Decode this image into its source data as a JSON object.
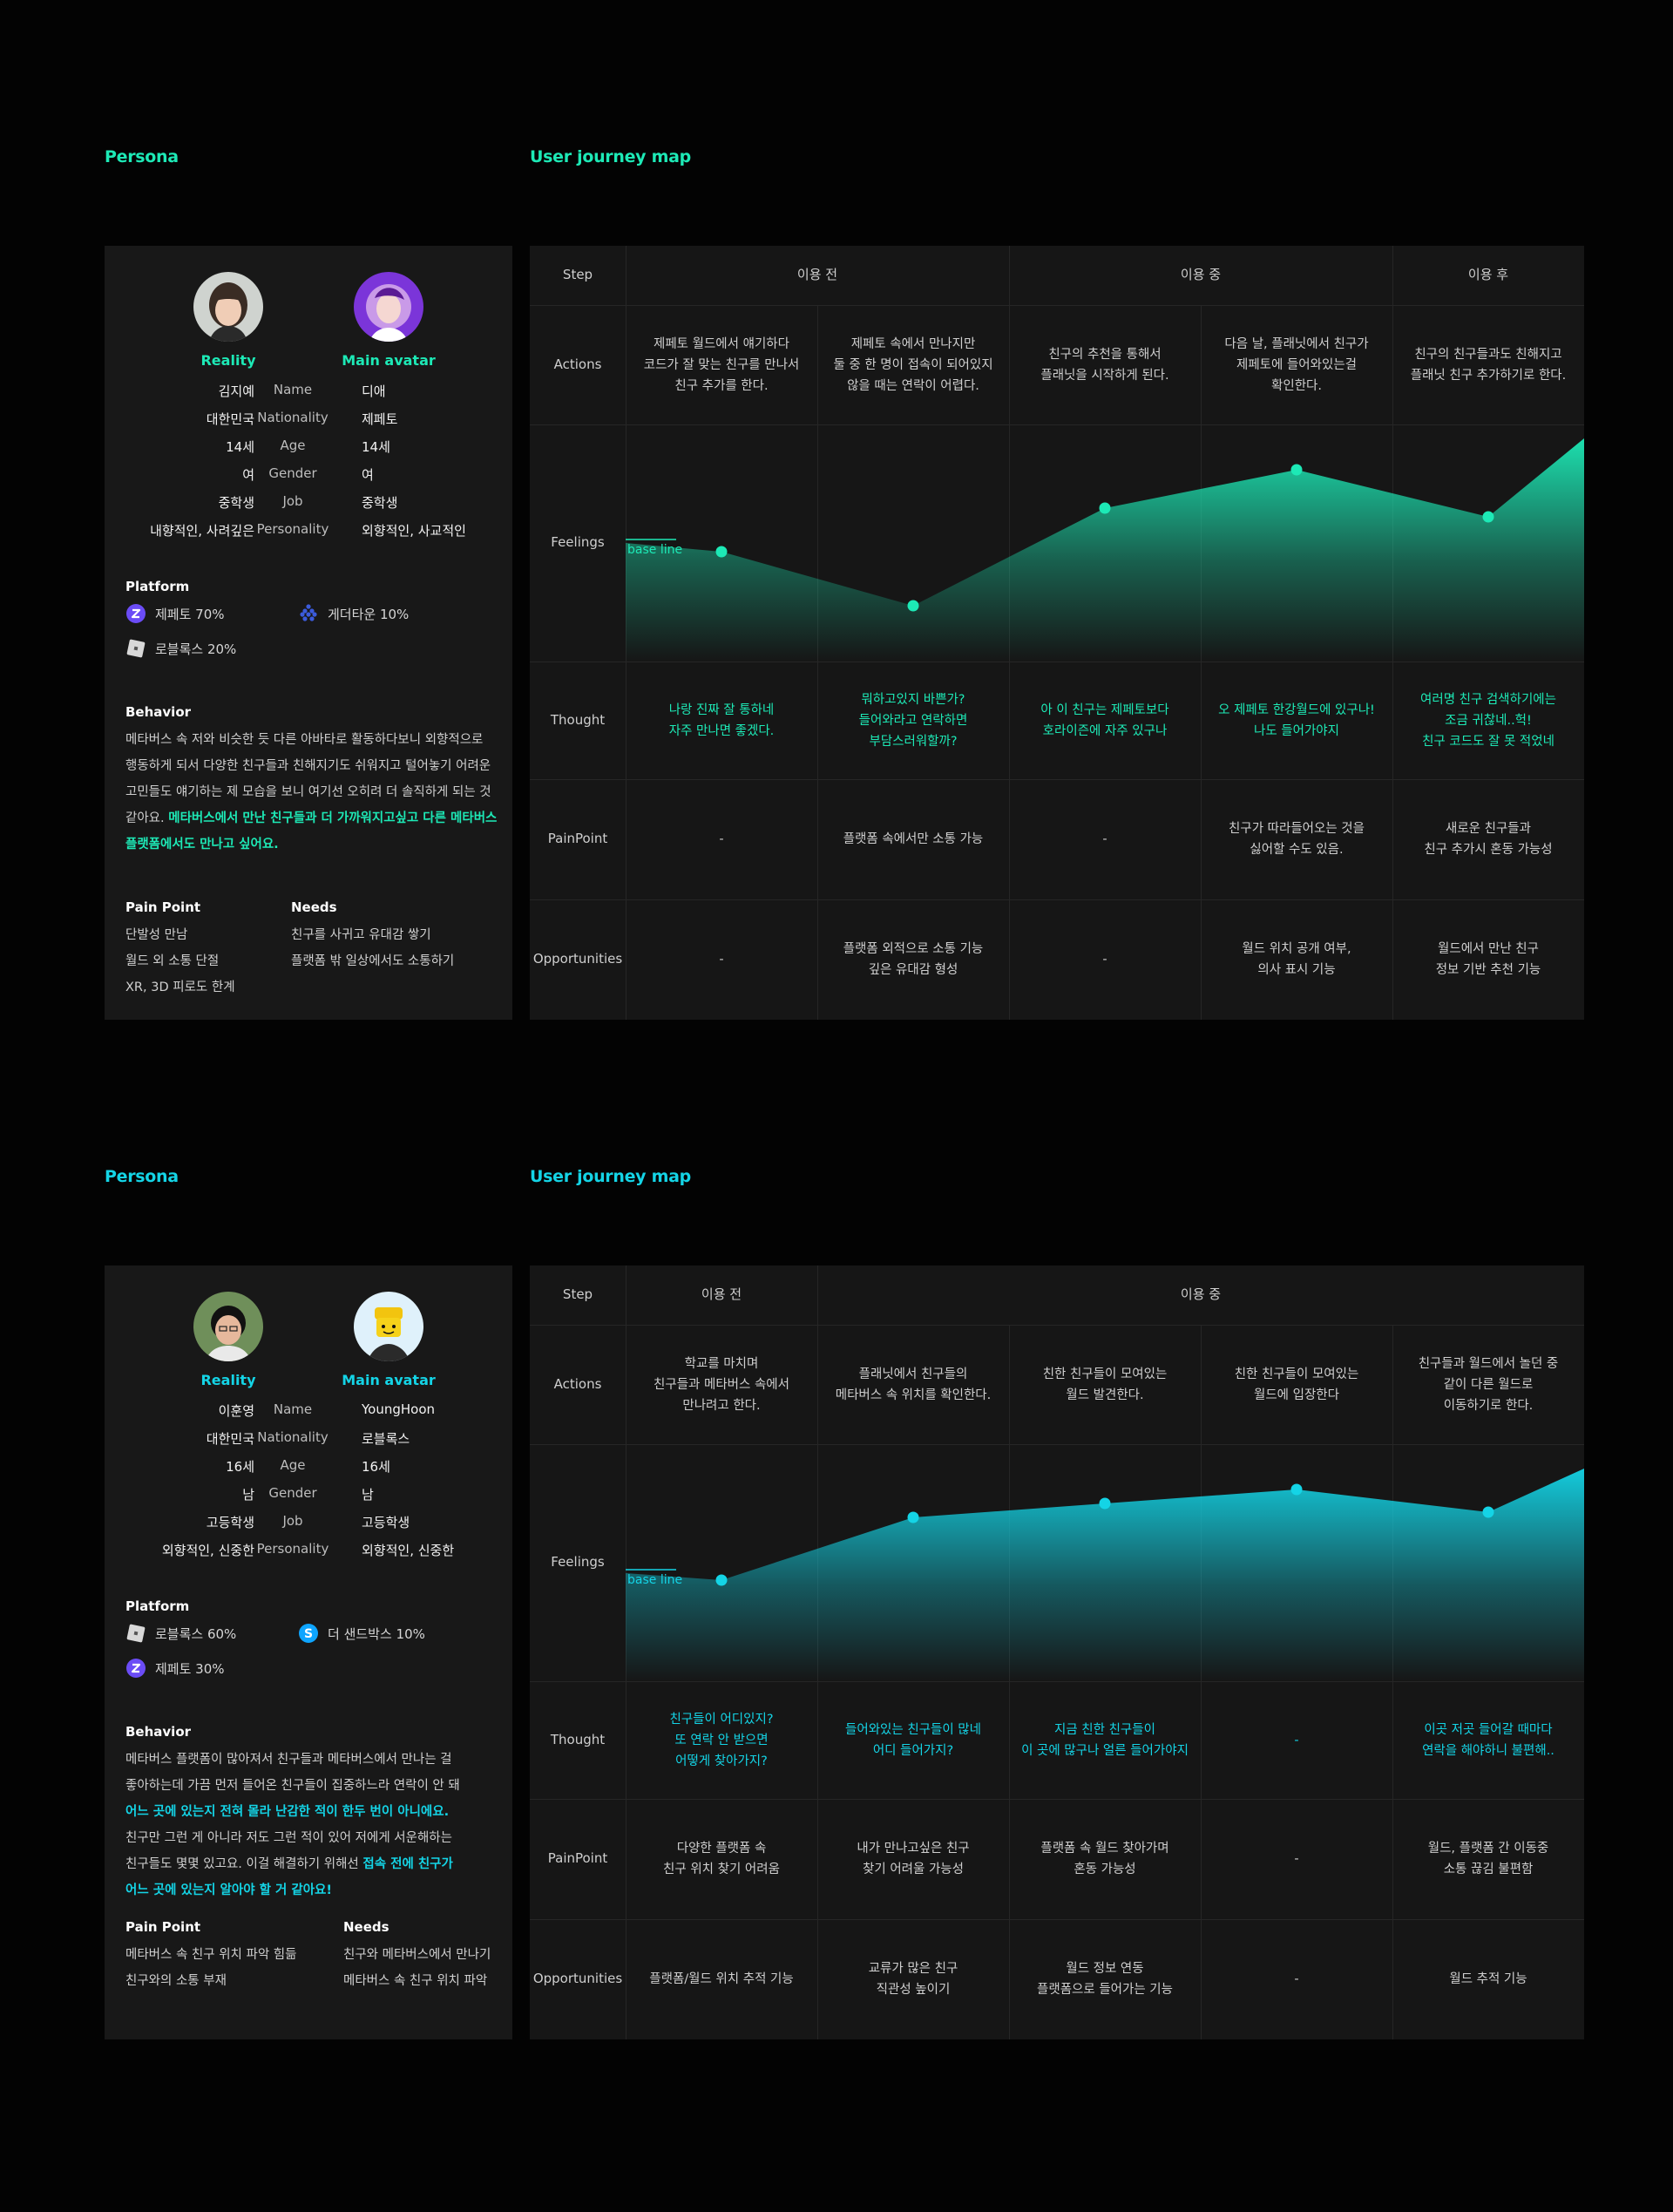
{
  "colors": {
    "accent_1": "#1de9b6",
    "accent_2": "#14d4e6",
    "bg": "#030303",
    "card": "#181818"
  },
  "sections": [
    {
      "persona_title": "Persona",
      "journey_title": "User journey map",
      "accent": "#1de9b6",
      "reality_label": "Reality",
      "avatar_label": "Main avatar",
      "attributes": [
        {
          "name": "Name",
          "reality": "김지예",
          "avatar": "디애"
        },
        {
          "name": "Nationality",
          "reality": "대한민국",
          "avatar": "제페토"
        },
        {
          "name": "Age",
          "reality": "14세",
          "avatar": "14세"
        },
        {
          "name": "Gender",
          "reality": "여",
          "avatar": "여"
        },
        {
          "name": "Job",
          "reality": "중학생",
          "avatar": "중학생"
        },
        {
          "name": "Personality",
          "reality": "내향적인, 사려깊은",
          "avatar": "외향적인, 사교적인"
        }
      ],
      "platform_title": "Platform",
      "platforms": [
        {
          "icon": "zepeto-icon",
          "label": "제페토 70%"
        },
        {
          "icon": "gather-town-icon",
          "label": "게더타운 10%"
        },
        {
          "icon": "roblox-icon",
          "label": "로블록스 20%"
        }
      ],
      "behavior_title": "Behavior",
      "behavior_lines": [
        {
          "text": "메타버스 속 저와 비슷한 듯 다른 아바타로 활동하다보니 외향적으로",
          "hl": ""
        },
        {
          "text": "행동하게 되서 다양한 친구들과 친해지기도 쉬워지고 털어놓기 어려운",
          "hl": ""
        },
        {
          "text": "고민들도 얘기하는 제 모습을 보니 여기선 오히려 더 솔직하게 되는 것",
          "hl": ""
        },
        {
          "text": "같아요. ",
          "hl": "메타버스에서 만난 친구들과 더 가까워지고싶고 다른 메타버스"
        },
        {
          "text": "",
          "hl": "플랫폼에서도 만나고 싶어요."
        }
      ],
      "pain_title": "Pain Point",
      "pain_points": [
        "단발성 만남",
        "월드 외 소통 단절",
        "XR, 3D 피로도 한계"
      ],
      "needs_title": "Needs",
      "needs": [
        "친구를 사귀고 유대감 쌓기",
        "플랫폼 밖 일상에서도 소통하기"
      ],
      "row_labels": [
        "Step",
        "Actions",
        "Feelings",
        "Thought",
        "PainPoint",
        "Opportunities"
      ],
      "phases": [
        {
          "label": "이용 전",
          "span": 2
        },
        {
          "label": "이용 중",
          "span": 2
        },
        {
          "label": "이용 후",
          "span": 1
        }
      ],
      "actions": [
        "제페토 월드에서 얘기하다\n코드가 잘 맞는 친구를 만나서\n친구 추가를 한다.",
        "제페토 속에서 만나지만\n둘 중 한 명이 접속이 되어있지\n않을 때는 연락이 어렵다.",
        "친구의 추천을 통해서\n플래닛을 시작하게 된다.",
        "다음 날, 플래닛에서 친구가\n제페토에 들어와있는걸\n확인한다.",
        "친구의 친구들과도 친해지고\n플래닛 친구 추가하기로 한다."
      ],
      "baseline_label": "base line",
      "chart_data": {
        "type": "area",
        "series": [
          {
            "values": [
              0.53,
              0.22,
              0.78,
              1.0,
              0.73,
              1.18
            ]
          }
        ],
        "baseline": 0.58,
        "note_points": [
          true,
          true,
          true,
          true,
          true,
          false
        ]
      },
      "thoughts": [
        "나랑 진짜 잘 통하네\n자주 만나면 좋겠다.",
        "뭐하고있지 바쁜가?\n들어와라고 연락하면\n부담스러워할까?",
        "아 이 친구는 제페토보다\n호라이즌에 자주 있구나",
        "오 제페토 한강월드에 있구나!\n나도 들어가야지",
        "여러명 친구 검색하기에는\n조금 귀찮네..헉!\n친구 코드도 잘 못 적었네"
      ],
      "pain_row": [
        "-",
        "플랫폼 속에서만 소통 가능",
        "-",
        "친구가 따라들어오는 것을\n싫어할 수도 있음.",
        "새로운 친구들과\n친구 추가시 혼동 가능성"
      ],
      "opportunities": [
        "-",
        "플랫폼 외적으로 소통 기능\n깊은 유대감 형성",
        "-",
        "월드 위치 공개 여부,\n의사 표시 기능",
        "월드에서 만난 친구\n정보 기반 추천 기능"
      ]
    },
    {
      "persona_title": "Persona",
      "journey_title": "User journey map",
      "accent": "#14d4e6",
      "reality_label": "Reality",
      "avatar_label": "Main avatar",
      "attributes": [
        {
          "name": "Name",
          "reality": "이훈영",
          "avatar": "YoungHoon"
        },
        {
          "name": "Nationality",
          "reality": "대한민국",
          "avatar": "로블록스"
        },
        {
          "name": "Age",
          "reality": "16세",
          "avatar": "16세"
        },
        {
          "name": "Gender",
          "reality": "남",
          "avatar": "남"
        },
        {
          "name": "Job",
          "reality": "고등학생",
          "avatar": "고등학생"
        },
        {
          "name": "Personality",
          "reality": "외향적인, 신중한",
          "avatar": "외향적인, 신중한"
        }
      ],
      "platform_title": "Platform",
      "platforms": [
        {
          "icon": "roblox-icon",
          "label": "로블록스 60%"
        },
        {
          "icon": "the-sandbox-icon",
          "label": "더 샌드박스 10%"
        },
        {
          "icon": "zepeto-icon",
          "label": "제페토 30%"
        }
      ],
      "behavior_title": "Behavior",
      "behavior_lines": [
        {
          "text": "메타버스 플랫폼이 많아져서 친구들과 메타버스에서 만나는 걸",
          "hl": ""
        },
        {
          "text": "좋아하는데 가끔 먼저 들어온 친구들이 집중하느라 연락이 안 돼",
          "hl": ""
        },
        {
          "text": "",
          "hl": "어느 곳에 있는지 전혀 몰라 난감한 적이 한두 번이 아니에요."
        },
        {
          "text": "친구만 그런 게 아니라 저도 그런 적이 있어 저에게 서운해하는",
          "hl": ""
        },
        {
          "text": "친구들도 몇몇 있고요. 이걸 해결하기 위해선 ",
          "hl": "접속 전에 친구가"
        },
        {
          "text": "",
          "hl": "어느 곳에 있는지 알아야 할 거 같아요!"
        }
      ],
      "pain_title": "Pain Point",
      "pain_points": [
        "메타버스 속 친구 위치 파악 힘듦",
        "친구와의 소통 부재"
      ],
      "needs_title": "Needs",
      "needs": [
        "친구와 메타버스에서 만나기",
        "메타버스 속 친구 위치 파악"
      ],
      "row_labels": [
        "Step",
        "Actions",
        "Feelings",
        "Thought",
        "PainPoint",
        "Opportunities"
      ],
      "phases": [
        {
          "label": "이용 전",
          "span": 1
        },
        {
          "label": "이용 중",
          "span": 4
        }
      ],
      "actions": [
        "학교를 마치며\n친구들과 메타버스 속에서\n만나려고 한다.",
        "플래닛에서 친구들의\n메타버스 속 위치를 확인한다.",
        "친한 친구들이 모여있는\n월드 발견한다.",
        "친한 친구들이 모여있는\n월드에 입장한다",
        "친구들과 월드에서 놀던 중\n같이 다른 월드로\n이동하기로 한다."
      ],
      "baseline_label": "base line",
      "chart_data": {
        "type": "area",
        "series": [
          {
            "values": [
              0.48,
              0.84,
              0.92,
              1.0,
              0.87,
              1.12
            ]
          }
        ],
        "baseline": 0.52,
        "note_points": [
          true,
          true,
          true,
          true,
          true,
          false
        ]
      },
      "thoughts": [
        "친구들이 어디있지?\n또 연락 안 받으면\n어떻게 찾아가지?",
        "들어와있는 친구들이 많네\n어디 들어가지?",
        "지금 친한 친구들이\n이 곳에 많구나 얼른 들어가야지",
        "-",
        "이곳 저곳 들어갈 때마다\n연락을 해야하니 불편해.."
      ],
      "pain_row": [
        "다양한 플랫폼 속\n친구 위치 찾기 어려움",
        "내가 만나고싶은 친구\n찾기 어려울 가능성",
        "플랫폼 속 월드 찾아가며\n혼동 가능성",
        "-",
        "월드, 플랫폼 간 이동중\n소통 끊김 불편함"
      ],
      "opportunities": [
        "플랫폼/월드 위치 추적 기능",
        "교류가 많은 친구\n직관성 높이기",
        "월드 정보 연동\n플랫폼으로 들어가는 기능",
        "-",
        "월드 추적 기능"
      ]
    }
  ]
}
